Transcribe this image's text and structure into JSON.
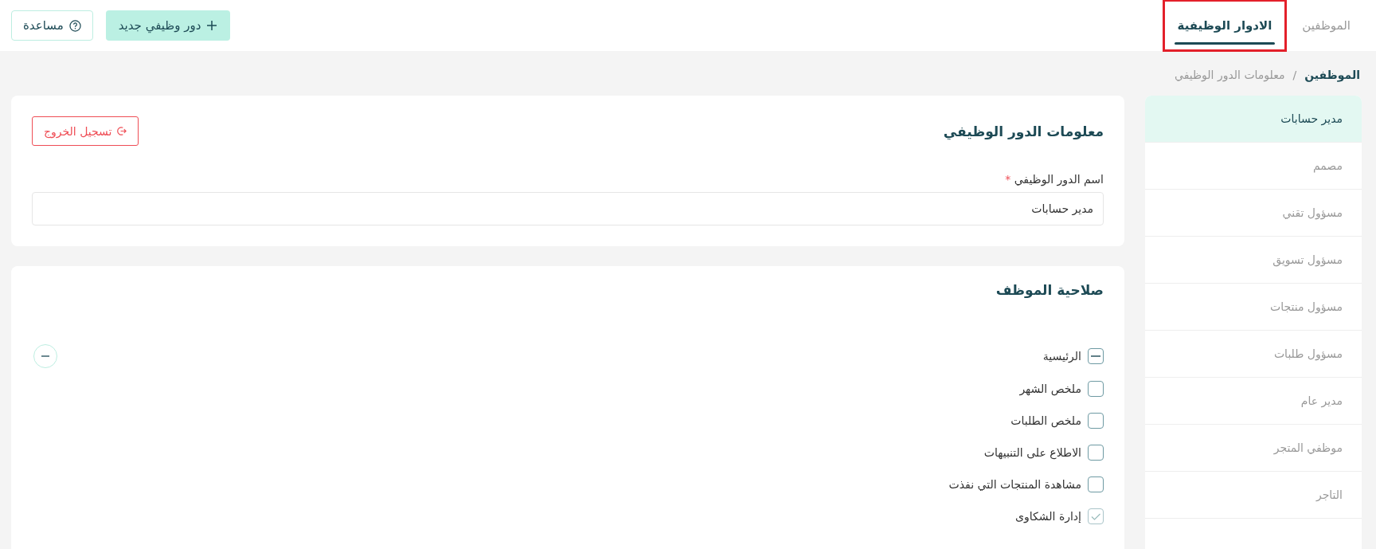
{
  "nav_tabs": [
    {
      "label": "الموظفين",
      "selected": false,
      "highlighted": false
    },
    {
      "label": "الادوار الوظيفية",
      "selected": true,
      "highlighted": true
    }
  ],
  "toolbar": {
    "new_button": "دور وظيفي جديد",
    "help_button": "مساعدة"
  },
  "breadcrumb": {
    "items": [
      "الموظفين",
      "معلومات الدور الوظيفي"
    ],
    "separator": "/"
  },
  "roles": [
    {
      "label": "مدير حسابات",
      "selected": true
    },
    {
      "label": "مصمم",
      "selected": false
    },
    {
      "label": "مسؤول تقني",
      "selected": false
    },
    {
      "label": "مسؤول تسويق",
      "selected": false
    },
    {
      "label": "مسؤول منتجات",
      "selected": false
    },
    {
      "label": "مسؤول طلبات",
      "selected": false
    },
    {
      "label": "مدير عام",
      "selected": false
    },
    {
      "label": "موظفي المتجر",
      "selected": false
    },
    {
      "label": "التاجر",
      "selected": false
    }
  ],
  "role_info": {
    "title": "معلومات الدور الوظيفي",
    "logout_button": "تسجيل الخروج",
    "field_label": "اسم الدور الوظيفي",
    "required_mark": "*",
    "field_value": "مدير حسابات"
  },
  "permissions": {
    "title": "صلاحية الموظف",
    "groups": [
      {
        "label": "الرئيسية",
        "indeterminate": true,
        "expanded": true,
        "children": [
          {
            "label": "ملخص الشهر",
            "checked": false
          },
          {
            "label": "ملخص الطلبات",
            "checked": false
          },
          {
            "label": "الاطلاع على التنبيهات",
            "checked": false
          },
          {
            "label": "مشاهدة المنتجات التي نفذت",
            "checked": false
          },
          {
            "label": "إدارة الشكاوى",
            "checked": true
          }
        ]
      }
    ]
  }
}
